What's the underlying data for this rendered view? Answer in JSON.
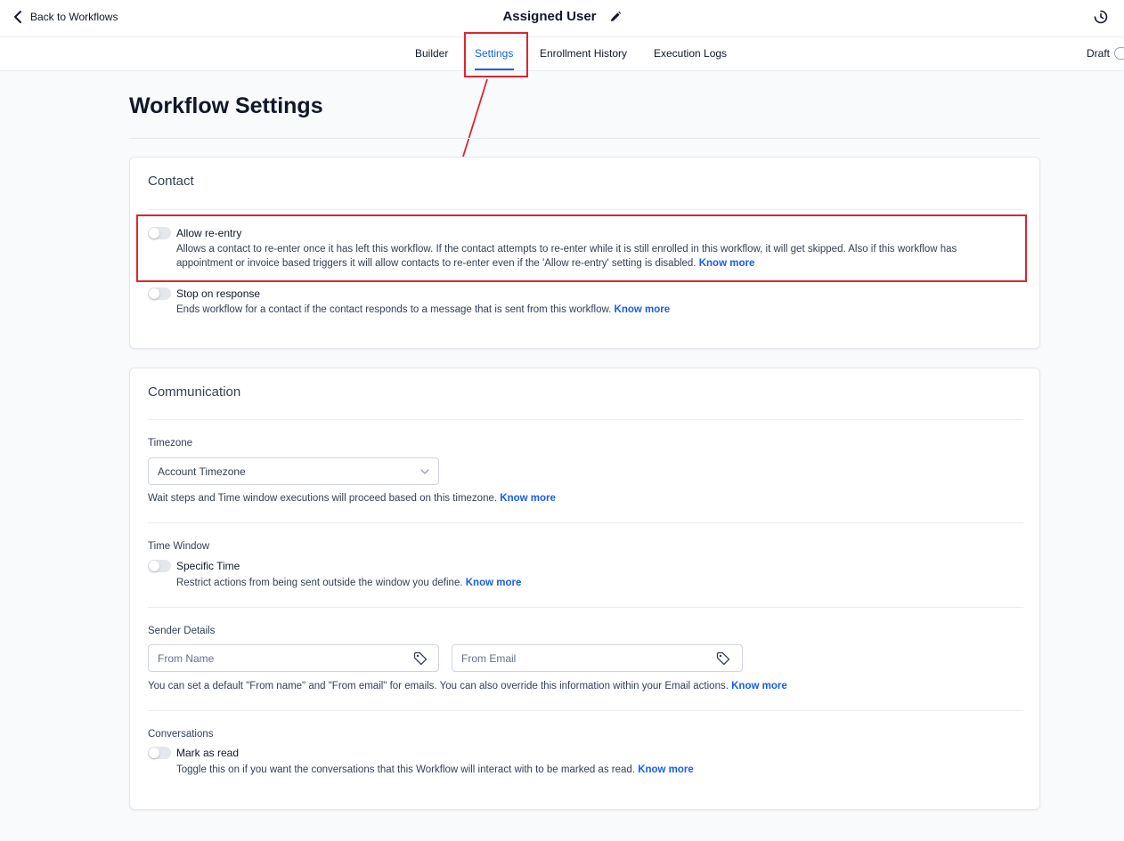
{
  "header": {
    "back_label": "Back to Workflows",
    "title": "Assigned User",
    "status_label": "Draft"
  },
  "tabs": [
    {
      "label": "Builder",
      "active": false
    },
    {
      "label": "Settings",
      "active": true
    },
    {
      "label": "Enrollment History",
      "active": false
    },
    {
      "label": "Execution Logs",
      "active": false
    }
  ],
  "page": {
    "title": "Workflow Settings"
  },
  "contact": {
    "title": "Contact",
    "allow_reentry": {
      "label": "Allow re-entry",
      "enabled": false,
      "description": "Allows a contact to re-enter once it has left this workflow. If the contact attempts to re-enter while it is still enrolled in this workflow, it will get skipped. Also if this workflow has appointment or invoice based triggers it will allow contacts to re-enter even if the 'Allow re-entry' setting is disabled.",
      "link": "Know more"
    },
    "stop_on_response": {
      "label": "Stop on response",
      "enabled": false,
      "description": "Ends workflow for a contact if the contact responds to a message that is sent from this workflow.",
      "link": "Know more"
    }
  },
  "communication": {
    "title": "Communication",
    "timezone": {
      "label": "Timezone",
      "selected": "Account Timezone",
      "description": "Wait steps and Time window executions will proceed based on this timezone.",
      "link": "Know more"
    },
    "time_window": {
      "label": "Time Window",
      "toggle_label": "Specific Time",
      "enabled": false,
      "description": "Restrict actions from being sent outside the window you define.",
      "link": "Know more"
    },
    "sender_details": {
      "label": "Sender Details",
      "from_name_placeholder": "From Name",
      "from_email_placeholder": "From Email",
      "description": "You can set a default \"From name\" and \"From email\" for emails. You can also override this information within your Email actions.",
      "link": "Know more"
    },
    "conversations": {
      "label": "Conversations",
      "toggle_label": "Mark as read",
      "enabled": false,
      "description": "Toggle this on if you want the conversations that this Workflow will interact with to be marked as read.",
      "link": "Know more"
    }
  },
  "icons": {
    "back": "chevron-left-icon",
    "edit": "pencil-icon",
    "history": "history-clock-icon",
    "dropdown": "chevron-down-icon",
    "tag": "tag-icon"
  },
  "colors": {
    "accent": "#155eef",
    "annotation": "#e0242f",
    "toggle_off": "#e4e7ec",
    "background": "#f9fafb"
  }
}
